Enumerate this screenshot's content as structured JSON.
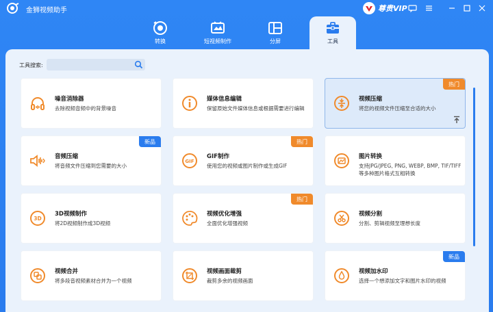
{
  "app": {
    "title": "金狮视频助手",
    "vip_label": "尊贵VIP"
  },
  "tabs": [
    {
      "label": "转换",
      "icon": "convert-icon",
      "active": false
    },
    {
      "label": "短视频制作",
      "icon": "short-video-icon",
      "active": false
    },
    {
      "label": "分屏",
      "icon": "split-screen-icon",
      "active": false
    },
    {
      "label": "工具",
      "icon": "toolbox-icon",
      "active": true
    }
  ],
  "search": {
    "label": "工具搜索:",
    "value": "",
    "placeholder": ""
  },
  "tools": [
    {
      "title": "噪音消除器",
      "desc": "去除视频音频中的背景噪音",
      "icon": "headphones-icon",
      "badge": ""
    },
    {
      "title": "媒体信息编辑",
      "desc": "保留原始文件媒体信息或根据需要进行编辑",
      "icon": "info-icon",
      "badge": ""
    },
    {
      "title": "视频压缩",
      "desc": "将您的视频文件压缩至合适的大小",
      "icon": "compress-icon",
      "badge": "热门"
    },
    {
      "title": "音频压缩",
      "desc": "将音频文件压缩到您需要的大小",
      "icon": "audio-compress-icon",
      "badge": "新品"
    },
    {
      "title": "GIF制作",
      "desc": "使用您的视频或图片制作或生成GIF",
      "icon": "gif-icon",
      "badge": "热门"
    },
    {
      "title": "图片转换",
      "desc": "支持JPG/JPEG, PNG, WEBP, BMP, TIF/TIFF等多种图片格式互相转换",
      "icon": "image-convert-icon",
      "badge": ""
    },
    {
      "title": "3D视频制作",
      "desc": "将2D视频制作成3D视频",
      "icon": "3d-icon",
      "badge": ""
    },
    {
      "title": "视频优化增强",
      "desc": "全面优化增强视频",
      "icon": "palette-icon",
      "badge": "热门"
    },
    {
      "title": "视频分割",
      "desc": "分割、剪辑视频至理想长度",
      "icon": "scissors-icon",
      "badge": ""
    },
    {
      "title": "视频合并",
      "desc": "将多段音视频素材合并为一个视频",
      "icon": "merge-icon",
      "badge": ""
    },
    {
      "title": "视频画面裁剪",
      "desc": "裁剪多余的视频画面",
      "icon": "crop-icon",
      "badge": ""
    },
    {
      "title": "视频加水印",
      "desc": "选择一个想添加文字和图片水印的视频",
      "icon": "watermark-icon",
      "badge": "新品"
    }
  ],
  "colors": {
    "accent": "#2a7cee",
    "hot": "#f08a2b",
    "panel": "#eaf2fc"
  }
}
